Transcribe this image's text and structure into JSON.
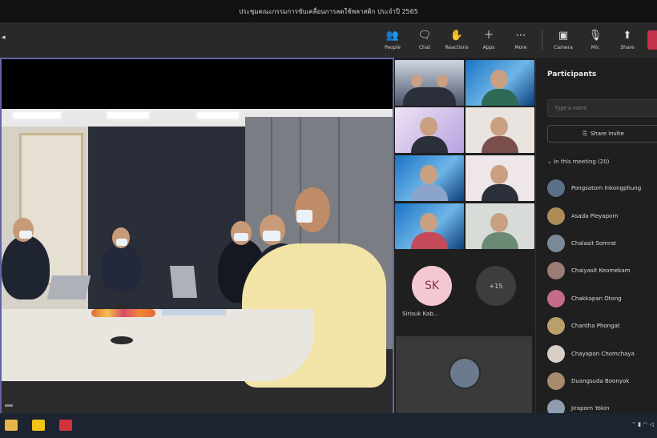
{
  "window": {
    "title": "ประชุมคณะกรรมการขับเคลื่อนการลดใช้พลาสติก ประจำปี 2565"
  },
  "toolbar": {
    "buttons": [
      {
        "label": "People",
        "icon": "people-icon"
      },
      {
        "label": "Chat",
        "icon": "chat-icon"
      },
      {
        "label": "Reactions",
        "icon": "reactions-icon"
      },
      {
        "label": "Apps",
        "icon": "apps-icon"
      },
      {
        "label": "More",
        "icon": "more-icon"
      }
    ],
    "controls": [
      {
        "label": "Camera",
        "icon": "camera-icon"
      },
      {
        "label": "Mic",
        "icon": "mic-icon"
      },
      {
        "label": "Share",
        "icon": "share-icon"
      }
    ]
  },
  "gallery": {
    "sk_initials": "SK",
    "sk_name": "Sirisuk Kab...",
    "more_count": "+15"
  },
  "participants": {
    "title": "Participants",
    "search_placeholder": "Type a name",
    "share_invite": "Share invite",
    "section": "In this meeting (20)",
    "people": [
      {
        "name": "Pongsatorn Inkongphung"
      },
      {
        "name": "Asada Pleyaporn"
      },
      {
        "name": "Chalasit Somrat"
      },
      {
        "name": "Chaiyasit Keomekam"
      },
      {
        "name": "Chakkapan Otong"
      },
      {
        "name": "Chantha Phongat"
      },
      {
        "name": "Chayapon Chomchaya"
      },
      {
        "name": "Duangsuda Boonyok"
      },
      {
        "name": "Jiraporn Yokin"
      }
    ]
  },
  "colors": {
    "accent": "#6264a7",
    "leave": "#c4314b",
    "panel_bg": "#1f1f1f"
  }
}
